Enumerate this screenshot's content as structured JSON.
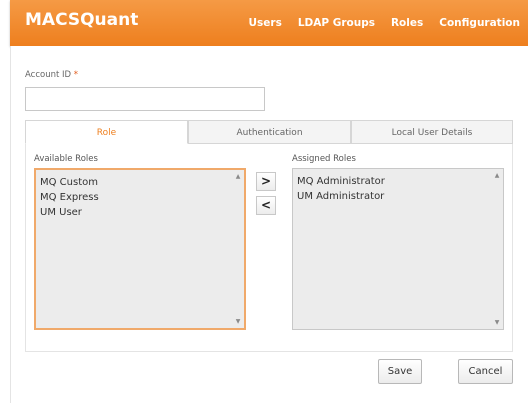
{
  "app": {
    "name": "MACSQuant"
  },
  "nav": [
    "Users",
    "LDAP Groups",
    "Roles",
    "Configuration"
  ],
  "account": {
    "label": "Account ID",
    "required_mark": "*",
    "value": ""
  },
  "tabs": [
    "Role",
    "Authentication",
    "Local User Details"
  ],
  "active_tab": "Role",
  "available_roles": {
    "label": "Available Roles",
    "items": [
      "MQ Custom",
      "MQ Express",
      "UM User"
    ]
  },
  "assigned_roles": {
    "label": "Assigned Roles",
    "items": [
      "MQ Administrator",
      "UM Administrator"
    ]
  },
  "move_buttons": {
    "add": ">",
    "remove": "<"
  },
  "scroll_arrows": {
    "up": "▲",
    "down": "▼"
  },
  "actions": {
    "save": "Save",
    "cancel": "Cancel"
  },
  "colors": {
    "accent": "#ee7f1e",
    "focus_border": "#f0a96a",
    "list_bg": "#ececec"
  }
}
